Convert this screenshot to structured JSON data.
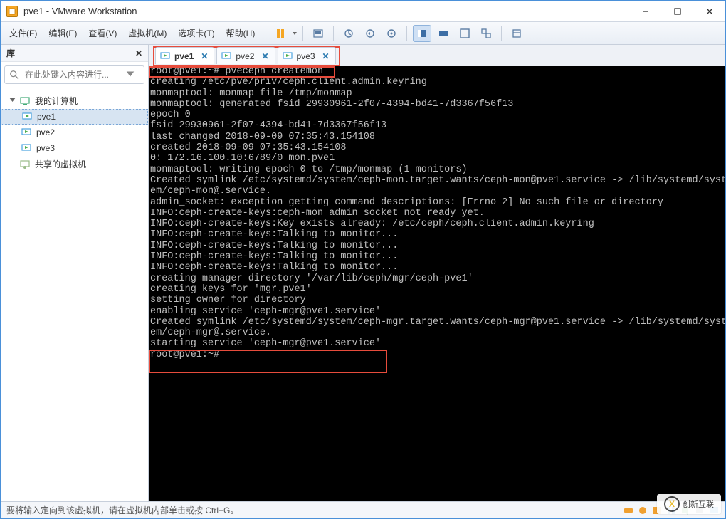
{
  "window": {
    "title": "pve1 - VMware Workstation"
  },
  "menu": {
    "file": "文件(F)",
    "edit": "编辑(E)",
    "view": "查看(V)",
    "vm": "虚拟机(M)",
    "tabs": "选项卡(T)",
    "help": "帮助(H)"
  },
  "sidebar": {
    "title": "库",
    "search_placeholder": "在此处键入内容进行...",
    "root": "我的计算机",
    "items": [
      "pve1",
      "pve2",
      "pve3"
    ],
    "shared": "共享的虚拟机"
  },
  "tabs": {
    "items": [
      {
        "label": "pve1",
        "active": true
      },
      {
        "label": "pve2",
        "active": false
      },
      {
        "label": "pve3",
        "active": false
      }
    ]
  },
  "terminal": {
    "lines": [
      "root@pve1:~# pveceph createmon",
      "creating /etc/pve/priv/ceph.client.admin.keyring",
      "monmaptool: monmap file /tmp/monmap",
      "monmaptool: generated fsid 29930961-2f07-4394-bd41-7d3367f56f13",
      "epoch 0",
      "fsid 29930961-2f07-4394-bd41-7d3367f56f13",
      "last_changed 2018-09-09 07:35:43.154108",
      "created 2018-09-09 07:35:43.154108",
      "0: 172.16.100.10:6789/0 mon.pve1",
      "monmaptool: writing epoch 0 to /tmp/monmap (1 monitors)",
      "Created symlink /etc/systemd/system/ceph-mon.target.wants/ceph-mon@pve1.service -> /lib/systemd/syst",
      "em/ceph-mon@.service.",
      "admin_socket: exception getting command descriptions: [Errno 2] No such file or directory",
      "INFO:ceph-create-keys:ceph-mon admin socket not ready yet.",
      "INFO:ceph-create-keys:Key exists already: /etc/ceph/ceph.client.admin.keyring",
      "INFO:ceph-create-keys:Talking to monitor...",
      "INFO:ceph-create-keys:Talking to monitor...",
      "INFO:ceph-create-keys:Talking to monitor...",
      "INFO:ceph-create-keys:Talking to monitor...",
      "creating manager directory '/var/lib/ceph/mgr/ceph-pve1'",
      "creating keys for 'mgr.pve1'",
      "setting owner for directory",
      "enabling service 'ceph-mgr@pve1.service'",
      "Created symlink /etc/systemd/system/ceph-mgr.target.wants/ceph-mgr@pve1.service -> /lib/systemd/syst",
      "em/ceph-mgr@.service.",
      "starting service 'ceph-mgr@pve1.service'",
      "root@pve1:~#"
    ]
  },
  "status": {
    "text": "要将输入定向到该虚拟机，请在虚拟机内部单击或按 Ctrl+G。"
  },
  "watermark": {
    "brand": "创新互联"
  }
}
